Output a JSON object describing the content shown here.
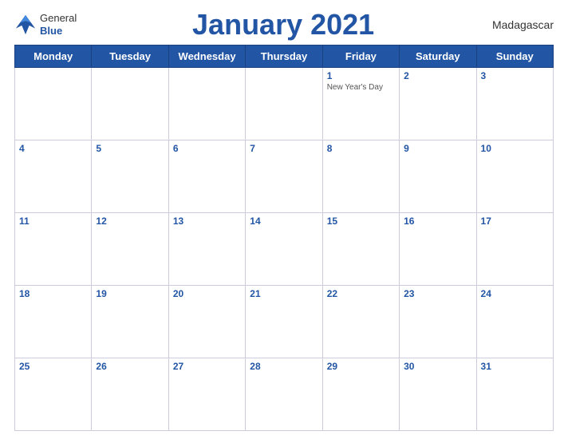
{
  "header": {
    "logo_general": "General",
    "logo_blue": "Blue",
    "title": "January 2021",
    "country": "Madagascar"
  },
  "days_of_week": [
    "Monday",
    "Tuesday",
    "Wednesday",
    "Thursday",
    "Friday",
    "Saturday",
    "Sunday"
  ],
  "weeks": [
    [
      {
        "day": "",
        "holiday": ""
      },
      {
        "day": "",
        "holiday": ""
      },
      {
        "day": "",
        "holiday": ""
      },
      {
        "day": "",
        "holiday": ""
      },
      {
        "day": "1",
        "holiday": "New Year's Day"
      },
      {
        "day": "2",
        "holiday": ""
      },
      {
        "day": "3",
        "holiday": ""
      }
    ],
    [
      {
        "day": "4",
        "holiday": ""
      },
      {
        "day": "5",
        "holiday": ""
      },
      {
        "day": "6",
        "holiday": ""
      },
      {
        "day": "7",
        "holiday": ""
      },
      {
        "day": "8",
        "holiday": ""
      },
      {
        "day": "9",
        "holiday": ""
      },
      {
        "day": "10",
        "holiday": ""
      }
    ],
    [
      {
        "day": "11",
        "holiday": ""
      },
      {
        "day": "12",
        "holiday": ""
      },
      {
        "day": "13",
        "holiday": ""
      },
      {
        "day": "14",
        "holiday": ""
      },
      {
        "day": "15",
        "holiday": ""
      },
      {
        "day": "16",
        "holiday": ""
      },
      {
        "day": "17",
        "holiday": ""
      }
    ],
    [
      {
        "day": "18",
        "holiday": ""
      },
      {
        "day": "19",
        "holiday": ""
      },
      {
        "day": "20",
        "holiday": ""
      },
      {
        "day": "21",
        "holiday": ""
      },
      {
        "day": "22",
        "holiday": ""
      },
      {
        "day": "23",
        "holiday": ""
      },
      {
        "day": "24",
        "holiday": ""
      }
    ],
    [
      {
        "day": "25",
        "holiday": ""
      },
      {
        "day": "26",
        "holiday": ""
      },
      {
        "day": "27",
        "holiday": ""
      },
      {
        "day": "28",
        "holiday": ""
      },
      {
        "day": "29",
        "holiday": ""
      },
      {
        "day": "30",
        "holiday": ""
      },
      {
        "day": "31",
        "holiday": ""
      }
    ]
  ]
}
